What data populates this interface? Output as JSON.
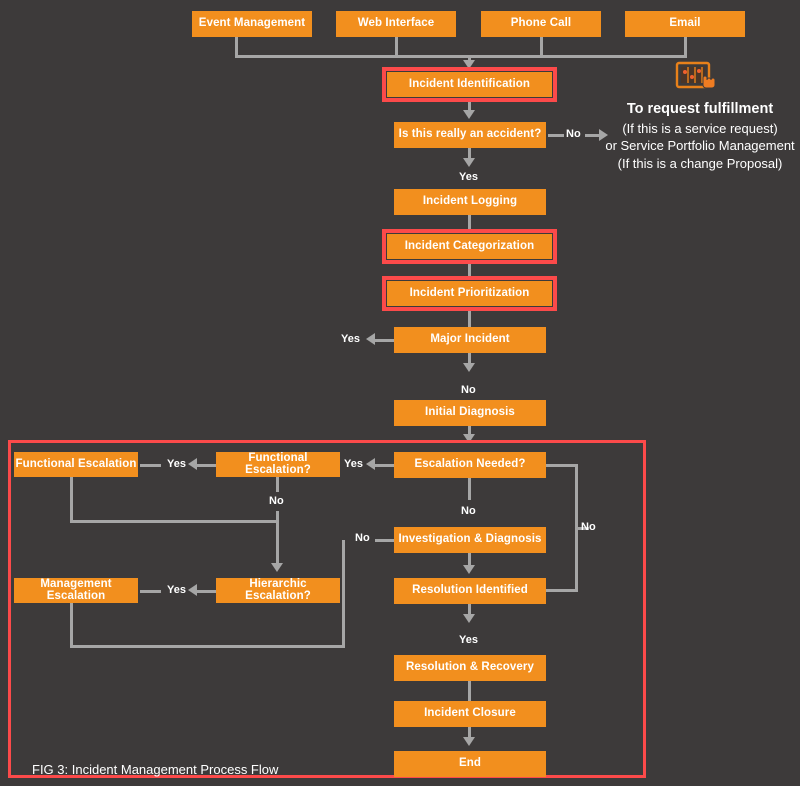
{
  "figure": {
    "caption": "FIG 3: Incident Management Process Flow",
    "colors": {
      "background": "#3d3a3a",
      "node": "#f28f1e",
      "node_text": "#ffffff",
      "highlight": "#fc4a4a",
      "connector": "#a6a6a6"
    }
  },
  "sources": [
    {
      "label": "Event Management"
    },
    {
      "label": "Web Interface"
    },
    {
      "label": "Phone Call"
    },
    {
      "label": "Email"
    }
  ],
  "nodes": {
    "incident_identification": "Incident Identification",
    "is_really_accident": "Is this really an accident?",
    "incident_logging": "Incident Logging",
    "incident_categorization": "Incident Categorization",
    "incident_prioritization": "Incident Prioritization",
    "major_incident": "Major Incident",
    "initial_diagnosis": "Initial Diagnosis",
    "escalation_needed": "Escalation Needed?",
    "functional_escalation_q": "Functional Escalation?",
    "functional_escalation": "Functional Escalation",
    "hierarchic_escalation_q": "Hierarchic Escalation?",
    "management_escalation": "Management Escalation",
    "investigation_diagnosis": "Investigation & Diagnosis",
    "resolution_identified": "Resolution Identified",
    "resolution_recovery": "Resolution & Recovery",
    "incident_closure": "Incident Closure",
    "end": "End"
  },
  "edge_labels": {
    "accident_no": "No",
    "accident_yes": "Yes",
    "major_yes": "Yes",
    "major_no": "No",
    "escalation_yes": "Yes",
    "escalation_no": "No",
    "escalation_right_no": "No",
    "functional_yes": "Yes",
    "functional_no": "No",
    "hierarchic_yes": "Yes",
    "investigation_no": "No",
    "resolution_yes": "Yes"
  },
  "annotation": {
    "icon": "service-request-icon",
    "title": "To request fulfillment",
    "line1": "(If this is a service request)",
    "line2": "or Service Portfolio Management",
    "line3": "(If this is a change Proposal)"
  }
}
